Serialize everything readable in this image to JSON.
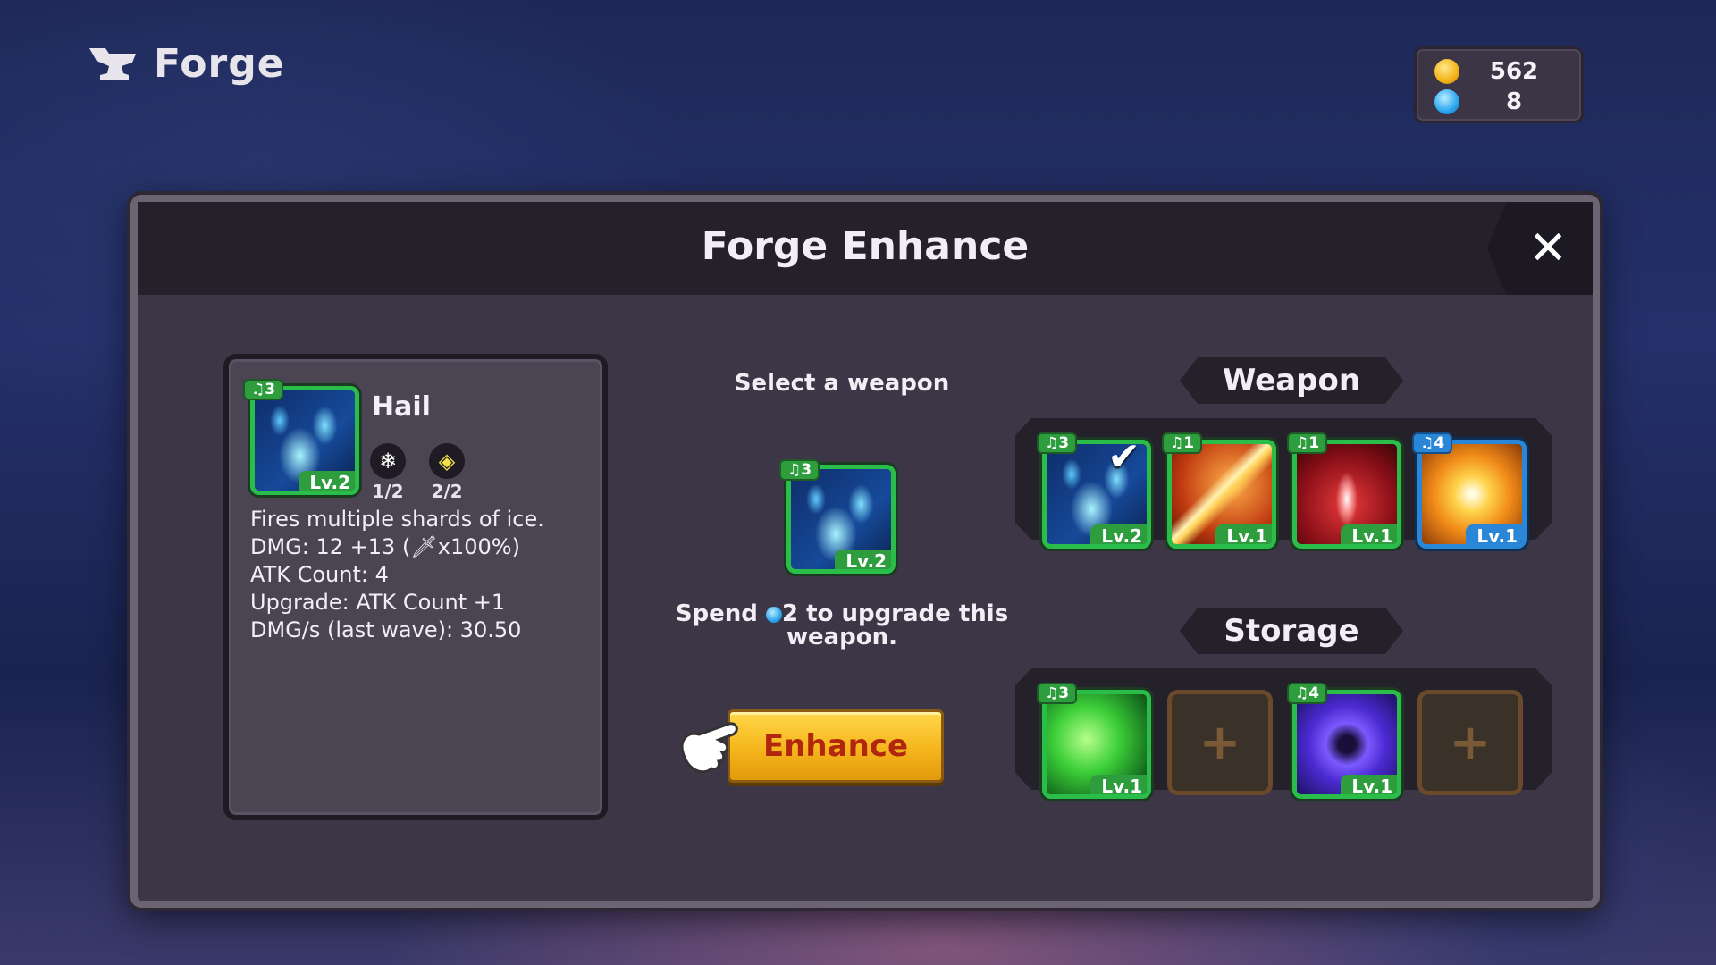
{
  "header": {
    "title": "Forge"
  },
  "currency": {
    "coins": "562",
    "gems": "8"
  },
  "panel": {
    "title": "Forge Enhance",
    "close": "✕"
  },
  "info": {
    "name": "Hail",
    "badge": "♫3",
    "level": "Lv.2",
    "stats": [
      {
        "icon": "❄",
        "value": "1/2"
      },
      {
        "icon": "◈",
        "value": "2/2"
      }
    ],
    "lines": [
      "Fires multiple shards of ice.",
      "DMG: 12 +13 (🗡x100%)",
      "ATK Count: 4",
      "Upgrade: ATK Count +1",
      "DMG/s (last wave):  30.50"
    ]
  },
  "middle": {
    "select_label": "Select a weapon",
    "selected": {
      "badge": "♫3",
      "level": "Lv.2"
    },
    "spend_prefix": "Spend ",
    "spend_suffix": "2 to upgrade this weapon.",
    "enhance": "Enhance"
  },
  "weapon_section": {
    "label": "Weapon",
    "items": [
      {
        "badge": "♫3",
        "level": "Lv.2",
        "art": "ice",
        "rarity": "green",
        "selected": true
      },
      {
        "badge": "♫1",
        "level": "Lv.1",
        "art": "sword",
        "rarity": "green"
      },
      {
        "badge": "♫1",
        "level": "Lv.1",
        "art": "spear",
        "rarity": "green"
      },
      {
        "badge": "♫4",
        "level": "Lv.1",
        "art": "star",
        "rarity": "blue"
      }
    ]
  },
  "storage_section": {
    "label": "Storage",
    "items": [
      {
        "badge": "♫3",
        "level": "Lv.1",
        "art": "skull"
      },
      {
        "empty": "+"
      },
      {
        "badge": "♫4",
        "level": "Lv.1",
        "art": "shuriken"
      },
      {
        "empty": "+"
      }
    ]
  },
  "colors": {
    "accent_green": "#2bbd4a",
    "accent_blue": "#2a86d6",
    "enhance_button": "#f5b51c",
    "enhance_text": "#b0260e"
  }
}
